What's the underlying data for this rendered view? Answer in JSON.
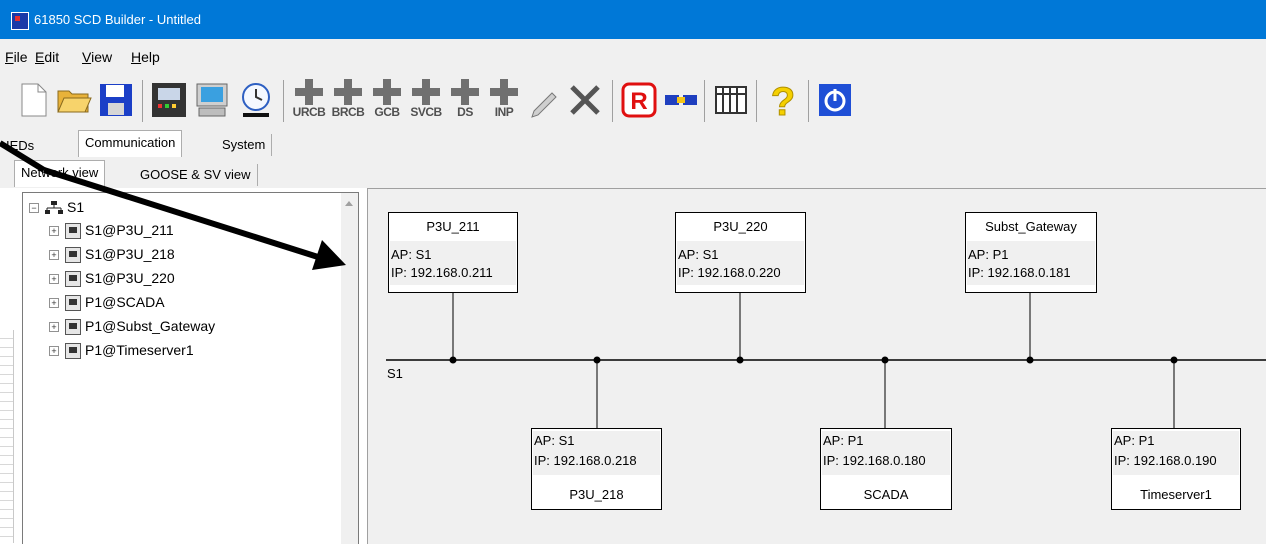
{
  "window": {
    "title": "61850 SCD Builder - Untitled"
  },
  "menu": [
    {
      "label": "File",
      "mnemonic": "F",
      "rest": "ile"
    },
    {
      "label": "Edit",
      "mnemonic": "E",
      "rest": "dit"
    },
    {
      "label": "View",
      "mnemonic": "V",
      "rest": "iew"
    },
    {
      "label": "Help",
      "mnemonic": "H",
      "rest": "elp"
    }
  ],
  "toolbar": {
    "add_buttons": [
      "URCB",
      "BRCB",
      "GCB",
      "SVCB",
      "DS",
      "INP"
    ],
    "icons": [
      "new-file-icon",
      "open-folder-icon",
      "save-icon",
      "ied-device-icon",
      "computer-icon",
      "clock-icon",
      "pencil-icon",
      "delete-x-icon",
      "r-icon",
      "plug-icon",
      "table-icon",
      "help-icon",
      "power-icon"
    ]
  },
  "tabs_main": {
    "ieds": "IEDs",
    "communication": "Communication",
    "system": "System"
  },
  "tabs_sub": {
    "network_view": "Network view",
    "goose_sv_view": "GOOSE & SV view"
  },
  "tree": {
    "root": "S1",
    "items": [
      "S1@P3U_211",
      "S1@P3U_218",
      "S1@P3U_220",
      "P1@SCADA",
      "P1@Subst_Gateway",
      "P1@Timeserver1"
    ]
  },
  "network": {
    "subnet_label": "S1",
    "ieds": [
      {
        "name": "P3U_211",
        "ap": "AP: S1",
        "ip": "IP: 192.168.0.211"
      },
      {
        "name": "P3U_220",
        "ap": "AP: S1",
        "ip": "IP: 192.168.0.220"
      },
      {
        "name": "Subst_Gateway",
        "ap": "AP: P1",
        "ip": "IP: 192.168.0.181"
      },
      {
        "name": "P3U_218",
        "ap": "AP: S1",
        "ip": "IP: 192.168.0.218"
      },
      {
        "name": "SCADA",
        "ap": "AP: P1",
        "ip": "IP: 192.168.0.180"
      },
      {
        "name": "Timeserver1",
        "ap": "AP: P1",
        "ip": "IP: 192.168.0.190"
      }
    ]
  }
}
